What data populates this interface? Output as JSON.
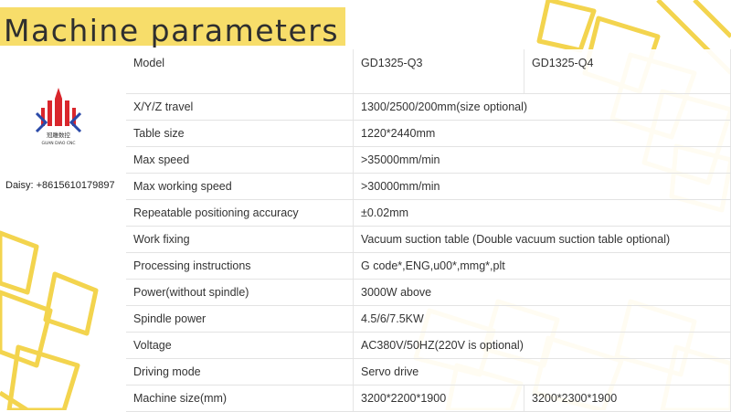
{
  "title": "Machine parameters",
  "logo": {
    "subtitle_cn": "冠雕数控",
    "subtitle_en": "GUAN DIAO CNC"
  },
  "contact": "Daisy:  +8615610179897",
  "colors": {
    "accent": "#f7dd6a",
    "logo_red": "#d9262c",
    "logo_blue": "#2a49a8"
  },
  "table": {
    "header": {
      "label": "Model",
      "col1": "GD1325-Q3",
      "col2": "GD1325-Q4"
    },
    "rows": [
      {
        "label": "X/Y/Z travel",
        "value": "1300/2500/200mm(size optional)"
      },
      {
        "label": "Table size",
        "value": "1220*2440mm"
      },
      {
        "label": "Max speed",
        "value": ">35000mm/min"
      },
      {
        "label": "Max working speed",
        "value": ">30000mm/min"
      },
      {
        "label": "Repeatable positioning accuracy",
        "value": "±0.02mm"
      },
      {
        "label": "Work fixing",
        "value": "Vacuum suction table (Double vacuum suction table optional)"
      },
      {
        "label": "Processing instructions",
        "value": "G code*,ENG,u00*,mmg*,plt"
      },
      {
        "label": "Power(without spindle)",
        "value": "3000W above"
      },
      {
        "label": "Spindle power",
        "value": "4.5/6/7.5KW"
      },
      {
        "label": "Voltage",
        "value": "AC380V/50HZ(220V is optional)"
      },
      {
        "label": "Driving mode",
        "value": "Servo drive"
      }
    ],
    "last_row": {
      "label": "Machine size(mm)",
      "col1": "3200*2200*1900",
      "col2": "3200*2300*1900"
    }
  }
}
